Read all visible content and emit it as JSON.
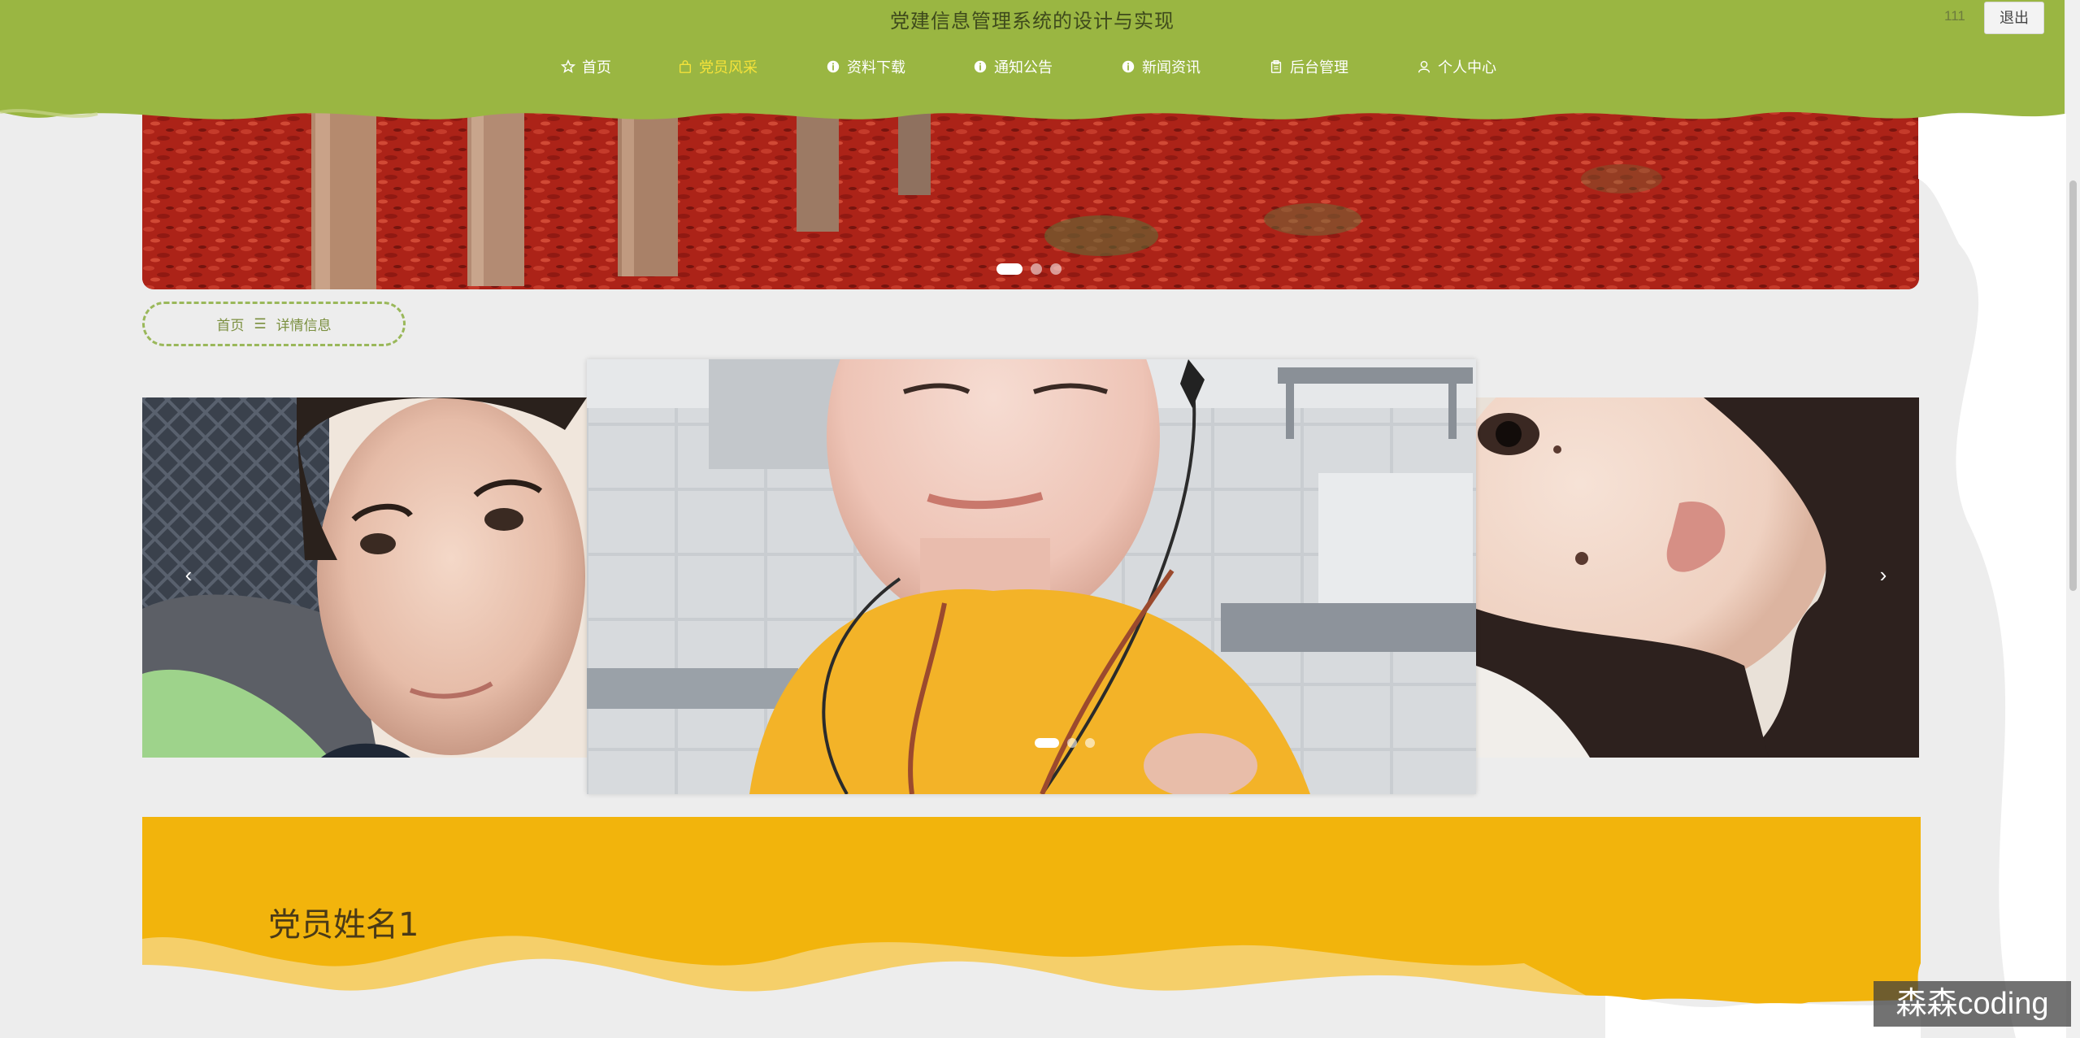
{
  "header": {
    "site_title": "党建信息管理系统的设计与实现",
    "username": "111",
    "logout_label": "退出",
    "bg_color": "#9ab642",
    "active_color": "#f4e23a"
  },
  "nav": {
    "items": [
      {
        "label": "首页",
        "icon": "star-icon"
      },
      {
        "label": "党员风采",
        "icon": "bag-icon",
        "active": true
      },
      {
        "label": "资料下载",
        "icon": "info-icon"
      },
      {
        "label": "通知公告",
        "icon": "info-icon"
      },
      {
        "label": "新闻资讯",
        "icon": "info-icon"
      },
      {
        "label": "后台管理",
        "icon": "clipboard-icon"
      },
      {
        "label": "个人中心",
        "icon": "user-icon"
      }
    ]
  },
  "banner": {
    "slides": 3,
    "active_slide": 1
  },
  "breadcrumb": {
    "home": "首页",
    "separator": "☰",
    "current": "详情信息"
  },
  "gallery": {
    "prev_label": "‹",
    "next_label": "›",
    "slides": 3,
    "active_slide": 1
  },
  "detail": {
    "member_name": "党员姓名1",
    "card_color": "#f2b40c"
  },
  "watermark": {
    "text": "森森coding"
  }
}
